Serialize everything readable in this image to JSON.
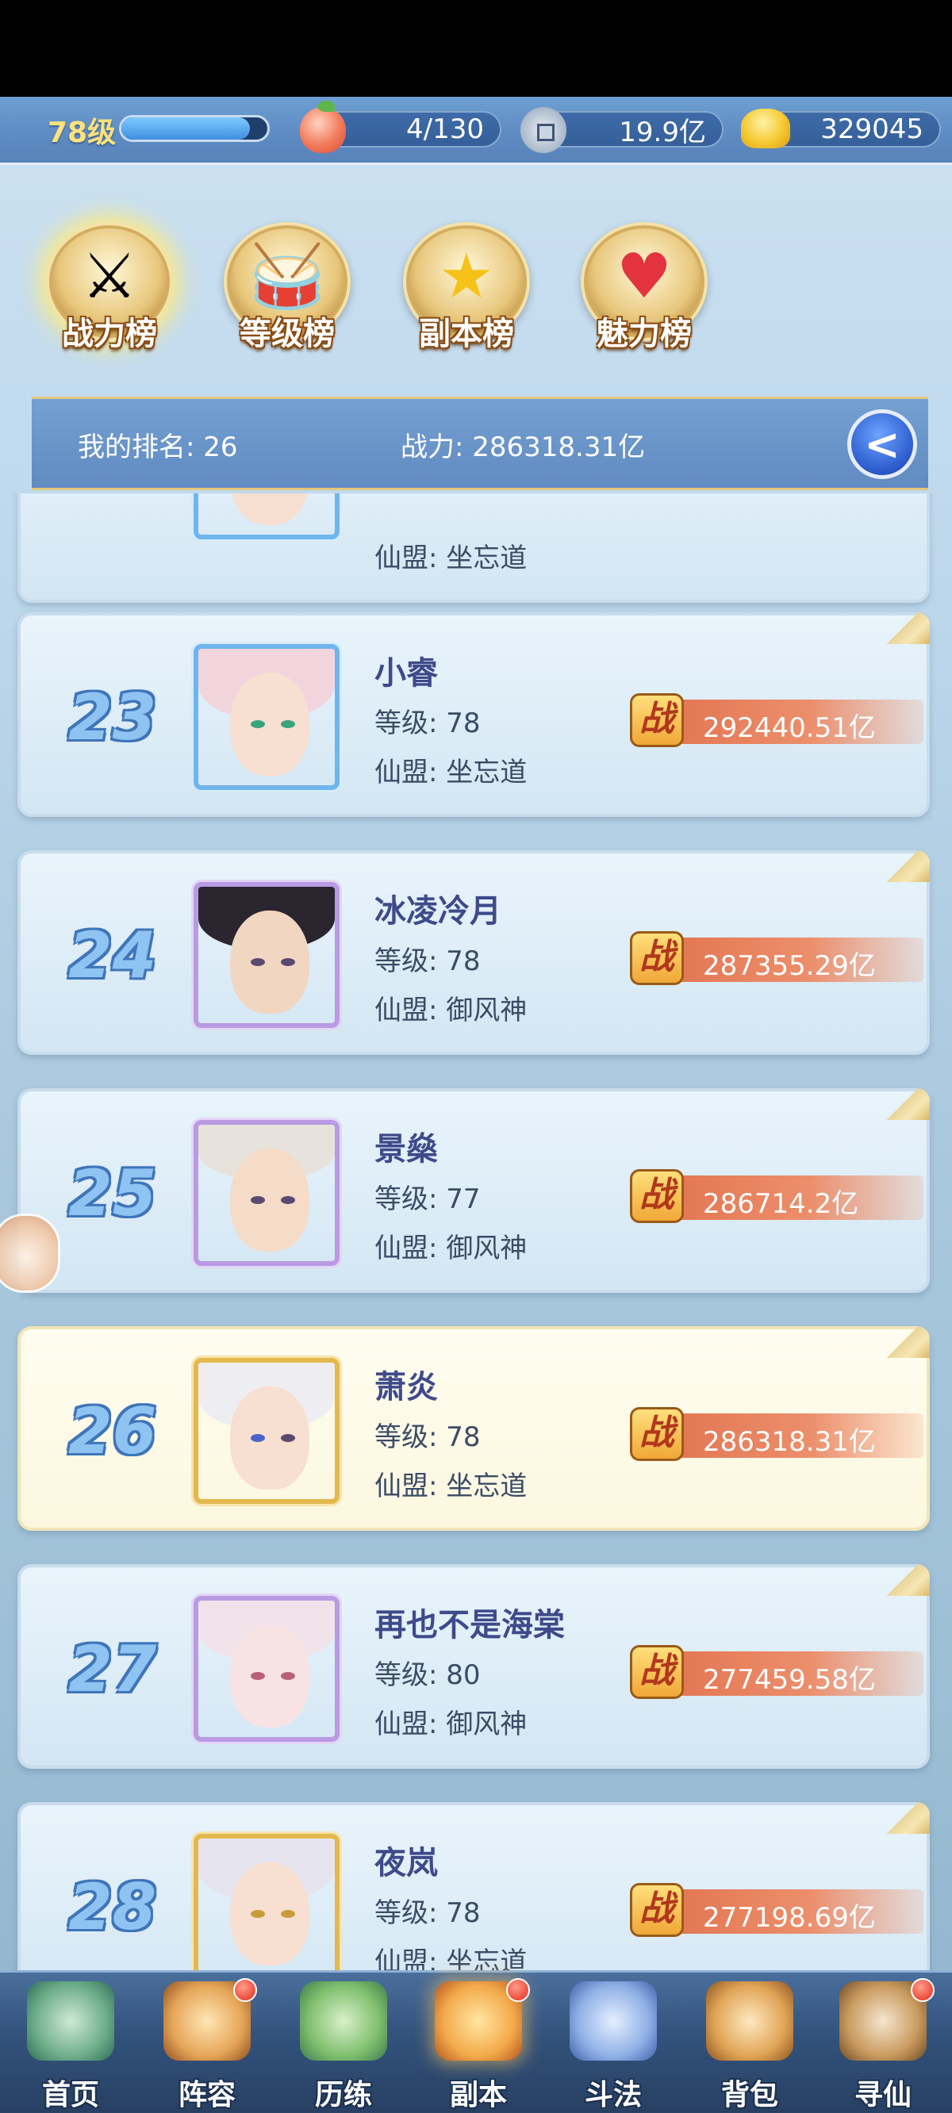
{
  "status": {
    "level": "78级",
    "exp_fraction": 0.88,
    "stamina": "4/130",
    "silver": "19.9亿",
    "gold": "329045",
    "icons": [
      "peach-icon",
      "coin-icon",
      "gold-ingot-icon"
    ]
  },
  "tabs": [
    {
      "label": "战力榜",
      "icon": "sword-emblem-icon",
      "active": true
    },
    {
      "label": "等级榜",
      "icon": "drum-emblem-icon",
      "active": false
    },
    {
      "label": "副本榜",
      "icon": "star-emblem-icon",
      "active": false
    },
    {
      "label": "魅力榜",
      "icon": "heart-emblem-icon",
      "active": false
    }
  ],
  "my_rank": {
    "rank_text": "我的排名: 26",
    "power_text": "战力: 286318.31亿",
    "back_icon": "back-arrow-icon"
  },
  "partial_top_row": {
    "guild": "仙盟: 坐忘道"
  },
  "rows": [
    {
      "rank": "23",
      "name": "小睿",
      "level": "等级: 78",
      "guild": "仙盟: 坐忘道",
      "power": "292440.51亿",
      "frame": "blue"
    },
    {
      "rank": "24",
      "name": "冰凌冷月",
      "level": "等级: 78",
      "guild": "仙盟: 御风神",
      "power": "287355.29亿",
      "frame": "purple"
    },
    {
      "rank": "25",
      "name": "景燊",
      "level": "等级: 77",
      "guild": "仙盟: 御风神",
      "power": "286714.2亿",
      "frame": "purple"
    },
    {
      "rank": "26",
      "name": "萧炎",
      "level": "等级: 78",
      "guild": "仙盟: 坐忘道",
      "power": "286318.31亿",
      "frame": "gold",
      "is_me": true
    },
    {
      "rank": "27",
      "name": "再也不是海棠",
      "level": "等级: 80",
      "guild": "仙盟: 御风神",
      "power": "277459.58亿",
      "frame": "purple"
    },
    {
      "rank": "28",
      "name": "夜岚",
      "level": "等级: 78",
      "guild": "仙盟: 坐忘道",
      "power": "277198.69亿",
      "frame": "gold"
    }
  ],
  "power_badge_glyph": "战",
  "nav": [
    {
      "label": "首页",
      "icon": "home-icon"
    },
    {
      "label": "阵容",
      "icon": "lineup-icon",
      "dot": true
    },
    {
      "label": "历练",
      "icon": "training-icon"
    },
    {
      "label": "副本",
      "icon": "dungeon-icon",
      "active": true,
      "dot": true
    },
    {
      "label": "斗法",
      "icon": "battle-icon"
    },
    {
      "label": "背包",
      "icon": "bag-icon"
    },
    {
      "label": "寻仙",
      "icon": "seek-immortal-icon",
      "dot": true
    }
  ]
}
